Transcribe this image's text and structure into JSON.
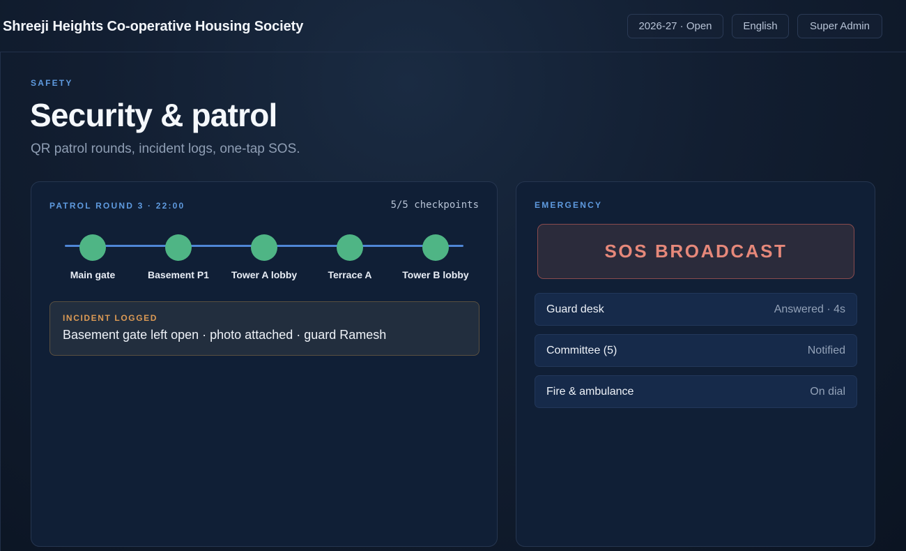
{
  "header": {
    "app_title": "Shreeji Heights Co-operative Housing Society",
    "year_pill": "2026-27 · Open",
    "language_pill": "English",
    "role_pill": "Super Admin"
  },
  "page": {
    "eyebrow": "SAFETY",
    "title": "Security & patrol",
    "subtitle": "QR patrol rounds, incident logs, one-tap SOS."
  },
  "patrol": {
    "eyebrow": "PATROL ROUND 3 · 22:00",
    "count": "5/5 checkpoints",
    "checkpoints": [
      {
        "label": "Main gate",
        "status": "done"
      },
      {
        "label": "Basement P1",
        "status": "done"
      },
      {
        "label": "Tower A lobby",
        "status": "done"
      },
      {
        "label": "Terrace A",
        "status": "done"
      },
      {
        "label": "Tower B lobby",
        "status": "done"
      }
    ],
    "incident": {
      "eyebrow": "INCIDENT LOGGED",
      "text": "Basement gate left open · photo attached · guard Ramesh"
    }
  },
  "emergency": {
    "eyebrow": "EMERGENCY",
    "sos_label": "SOS BROADCAST",
    "contacts": [
      {
        "name": "Guard desk",
        "status": "Answered · 4s"
      },
      {
        "name": "Committee (5)",
        "status": "Notified"
      },
      {
        "name": "Fire & ambulance",
        "status": "On dial"
      }
    ]
  },
  "colors": {
    "accent": "#5f9be0",
    "checkpoint_done": "#4fb585",
    "incident": "#dc9a55",
    "sos": "#e6887a"
  }
}
